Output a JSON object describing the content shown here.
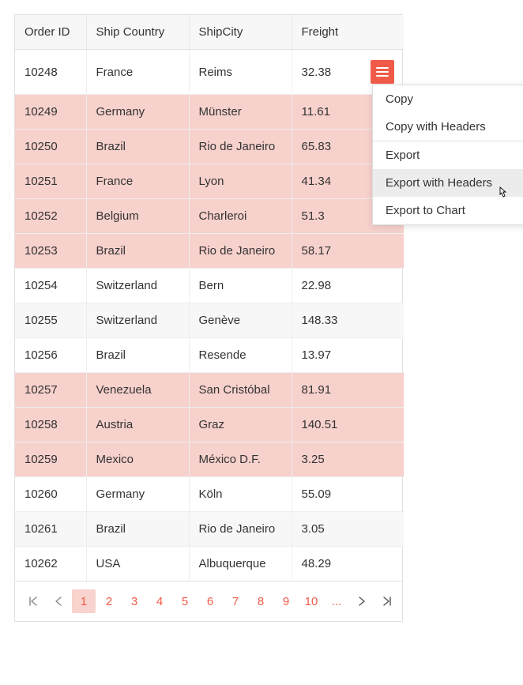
{
  "columns": {
    "order_id": "Order ID",
    "ship_country": "Ship Country",
    "ship_city": "ShipCity",
    "freight": "Freight"
  },
  "rows": [
    {
      "id": "10248",
      "country": "France",
      "city": "Reims",
      "freight": "32.38",
      "highlight": false,
      "stripe": false,
      "has_menu": true
    },
    {
      "id": "10249",
      "country": "Germany",
      "city": "Münster",
      "freight": "11.61",
      "highlight": true,
      "stripe": false
    },
    {
      "id": "10250",
      "country": "Brazil",
      "city": "Rio de Janeiro",
      "freight": "65.83",
      "highlight": true,
      "stripe": false
    },
    {
      "id": "10251",
      "country": "France",
      "city": "Lyon",
      "freight": "41.34",
      "highlight": true,
      "stripe": false
    },
    {
      "id": "10252",
      "country": "Belgium",
      "city": "Charleroi",
      "freight": "51.3",
      "highlight": true,
      "stripe": false
    },
    {
      "id": "10253",
      "country": "Brazil",
      "city": "Rio de Janeiro",
      "freight": "58.17",
      "highlight": true,
      "stripe": false
    },
    {
      "id": "10254",
      "country": "Switzerland",
      "city": "Bern",
      "freight": "22.98",
      "highlight": false,
      "stripe": false
    },
    {
      "id": "10255",
      "country": "Switzerland",
      "city": "Genève",
      "freight": "148.33",
      "highlight": false,
      "stripe": true
    },
    {
      "id": "10256",
      "country": "Brazil",
      "city": "Resende",
      "freight": "13.97",
      "highlight": false,
      "stripe": false
    },
    {
      "id": "10257",
      "country": "Venezuela",
      "city": "San Cristóbal",
      "freight": "81.91",
      "highlight": true,
      "stripe": false
    },
    {
      "id": "10258",
      "country": "Austria",
      "city": "Graz",
      "freight": "140.51",
      "highlight": true,
      "stripe": false
    },
    {
      "id": "10259",
      "country": "Mexico",
      "city": "México D.F.",
      "freight": "3.25",
      "highlight": true,
      "stripe": false
    },
    {
      "id": "10260",
      "country": "Germany",
      "city": "Köln",
      "freight": "55.09",
      "highlight": false,
      "stripe": false
    },
    {
      "id": "10261",
      "country": "Brazil",
      "city": "Rio de Janeiro",
      "freight": "3.05",
      "highlight": false,
      "stripe": true
    },
    {
      "id": "10262",
      "country": "USA",
      "city": "Albuquerque",
      "freight": "48.29",
      "highlight": false,
      "stripe": false
    }
  ],
  "context_menu": {
    "items": [
      {
        "label": "Copy",
        "hovered": false
      },
      {
        "label": "Copy with Headers",
        "hovered": false
      }
    ],
    "items2": [
      {
        "label": "Export",
        "hovered": false
      },
      {
        "label": "Export with Headers",
        "hovered": true
      },
      {
        "label": "Export to Chart",
        "hovered": false
      }
    ]
  },
  "pagination": {
    "pages": [
      "1",
      "2",
      "3",
      "4",
      "5",
      "6",
      "7",
      "8",
      "9",
      "10"
    ],
    "ellipsis": "...",
    "current": "1"
  },
  "colors": {
    "accent": "#ef5b48",
    "highlight_row": "#f7d1cc"
  }
}
